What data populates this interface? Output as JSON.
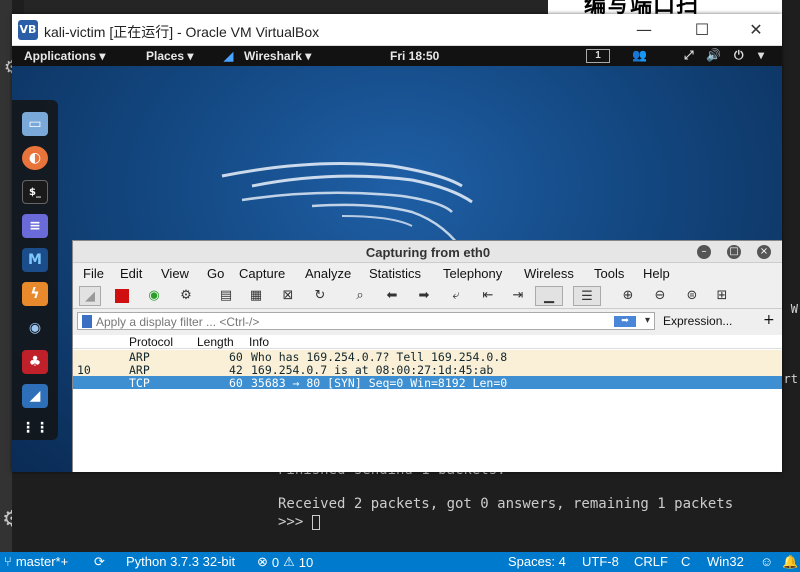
{
  "vscode": {
    "header_text": "编写端口扫",
    "side_text_1": "W",
    "side_text_2": "rt",
    "terminal_partial": "Finished sending 1 packets.",
    "terminal_line_1": "Received 2 packets, got 0 answers, remaining 1 packets",
    "terminal_prompt": ">>> "
  },
  "statusbar": {
    "branch": "master*+",
    "python": "Python 3.7.3 32-bit",
    "errors": "0",
    "warnings": "10",
    "spaces": "Spaces: 4",
    "encoding": "UTF-8",
    "eol": "CRLF",
    "language": "C",
    "platform": "Win32"
  },
  "vbox": {
    "title": "kali-victim [正在运行] - Oracle VM VirtualBox"
  },
  "kali_panel": {
    "applications": "Applications ▾",
    "places": "Places ▾",
    "wireshark": "Wireshark ▾",
    "clock": "Fri 18:50",
    "workspace": "1"
  },
  "wireshark": {
    "title": "Capturing from eth0",
    "menu": [
      "File",
      "Edit",
      "View",
      "Go",
      "Capture",
      "Analyze",
      "Statistics",
      "Telephony",
      "Wireless",
      "Tools",
      "Help"
    ],
    "filter_placeholder": "Apply a display filter ... <Ctrl-/>",
    "expression": "Expression...",
    "plus": "+",
    "columns": [
      "Protocol",
      "Length",
      "Info"
    ],
    "packets": [
      {
        "no": "",
        "protocol": "ARP",
        "length": "60",
        "info": "Who has 169.254.0.7? Tell 169.254.0.8",
        "color": "#faf0d7",
        "text": "#12272e"
      },
      {
        "no": "10",
        "protocol": "ARP",
        "length": "42",
        "info": "169.254.0.7 is at 08:00:27:1d:45:ab",
        "color": "#faf0d7",
        "text": "#12272e"
      },
      {
        "no": "",
        "protocol": "TCP",
        "length": "60",
        "info": "35683 → 80 [SYN] Seq=0 Win=8192 Len=0",
        "color": "#3d8fd1",
        "text": "#ffffff"
      }
    ]
  }
}
